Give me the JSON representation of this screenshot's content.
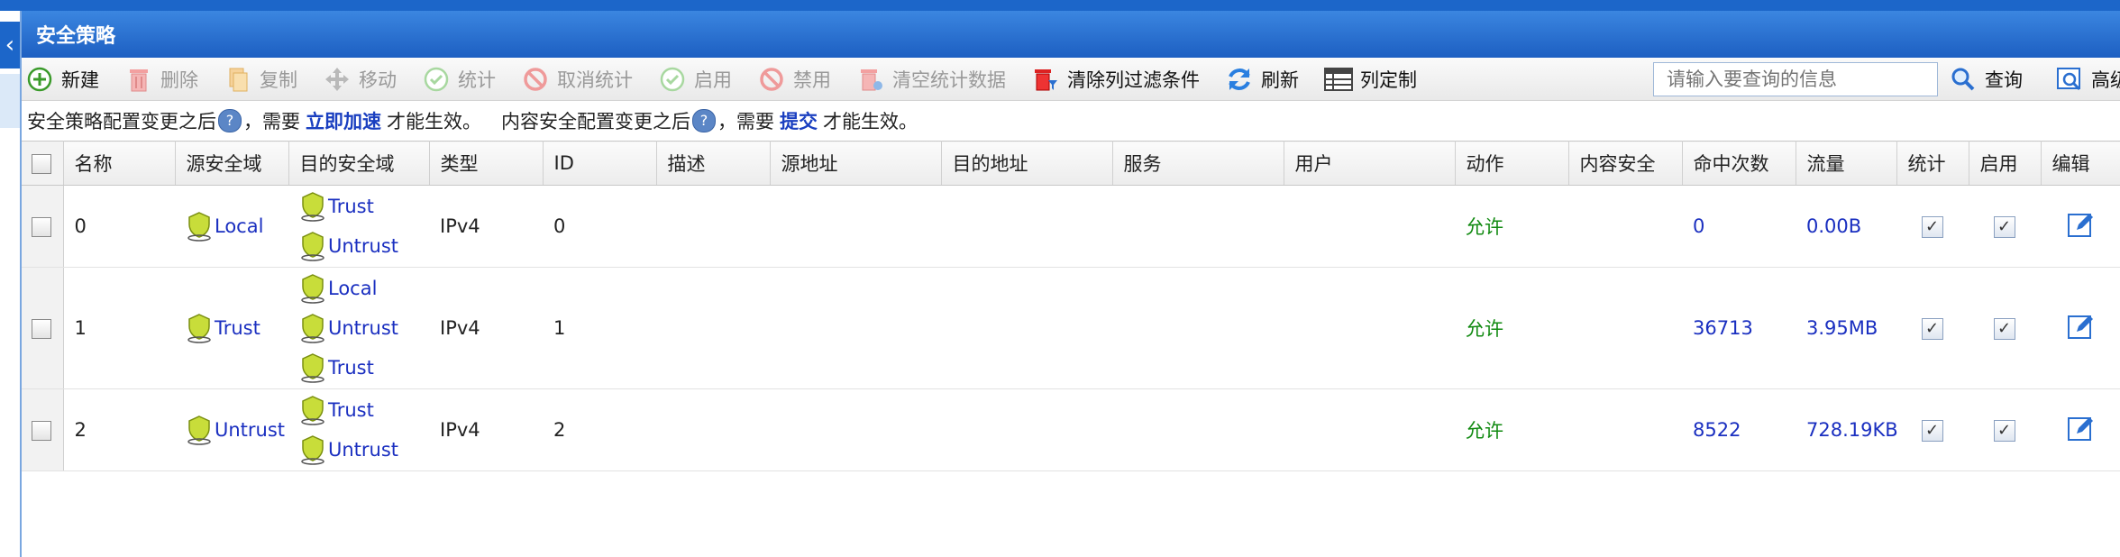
{
  "window": {
    "title": "安全策略"
  },
  "toolbar": {
    "buttons": [
      {
        "label": "新建",
        "icon": "add-circle-icon",
        "enabled": true
      },
      {
        "label": "删除",
        "icon": "trash-icon",
        "enabled": false
      },
      {
        "label": "复制",
        "icon": "copy-icon",
        "enabled": false
      },
      {
        "label": "移动",
        "icon": "move-icon",
        "enabled": false
      },
      {
        "label": "统计",
        "icon": "check-circle-icon",
        "enabled": false
      },
      {
        "label": "取消统计",
        "icon": "forbid-icon",
        "enabled": false
      },
      {
        "label": "启用",
        "icon": "check-circle-icon",
        "enabled": false
      },
      {
        "label": "禁用",
        "icon": "forbid-icon",
        "enabled": false
      },
      {
        "label": "清空统计数据",
        "icon": "clear-trash-icon",
        "enabled": false
      },
      {
        "label": "清除列过滤条件",
        "icon": "filter-clear-icon",
        "enabled": true
      },
      {
        "label": "刷新",
        "icon": "refresh-icon",
        "enabled": true
      },
      {
        "label": "列定制",
        "icon": "columns-icon",
        "enabled": true
      }
    ],
    "search_placeholder": "请输入要查询的信息",
    "query_label": "查询",
    "advanced_label": "高级查"
  },
  "notice": {
    "part1": "安全策略配置变更之后",
    "part2": "，需要",
    "link1": "立即加速",
    "part3": "才能生效。",
    "part4": "内容安全配置变更之后",
    "part5": "，需要",
    "link2": "提交",
    "part6": "才能生效。",
    "help": "?"
  },
  "table": {
    "headers": [
      "名称",
      "源安全域",
      "目的安全域",
      "类型",
      "ID",
      "描述",
      "源地址",
      "目的地址",
      "服务",
      "用户",
      "动作",
      "内容安全",
      "命中次数",
      "流量",
      "统计",
      "启用",
      "编辑"
    ],
    "rows": [
      {
        "name": "0",
        "src_zones": [
          "Local"
        ],
        "dst_zones": [
          "Trust",
          "Untrust"
        ],
        "type": "IPv4",
        "id": "0",
        "action": "允许",
        "hits": "0",
        "traffic": "0.00B",
        "stat": true,
        "enable": true
      },
      {
        "name": "1",
        "src_zones": [
          "Trust"
        ],
        "dst_zones": [
          "Local",
          "Untrust",
          "Trust"
        ],
        "type": "IPv4",
        "id": "1",
        "action": "允许",
        "hits": "36713",
        "traffic": "3.95MB",
        "stat": true,
        "enable": true
      },
      {
        "name": "2",
        "src_zones": [
          "Untrust"
        ],
        "dst_zones": [
          "Trust",
          "Untrust"
        ],
        "type": "IPv4",
        "id": "2",
        "action": "允许",
        "hits": "8522",
        "traffic": "728.19KB",
        "stat": true,
        "enable": true
      }
    ]
  },
  "colors": {
    "title_bar": "#1d5fc2",
    "link": "#1a3fc0",
    "action_allow": "#118a11"
  }
}
